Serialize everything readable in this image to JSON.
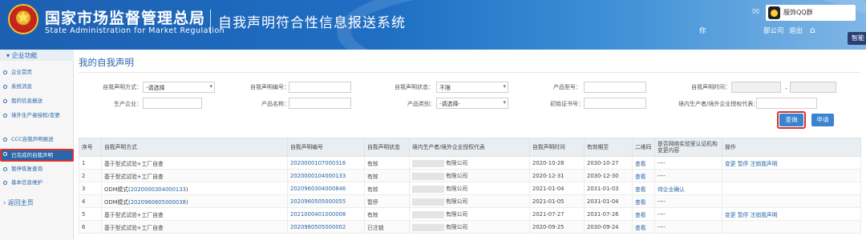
{
  "header": {
    "org_name_cn": "国家市场监督管理总局",
    "org_name_en": "State Administration  for  Market Regulation",
    "system_title": "自我声明符合性信息报送系统",
    "user_name": "服饰QQ群",
    "links": {
      "user_center": "你",
      "company": "部公司",
      "logout": "退出"
    },
    "smart_tab": "智能"
  },
  "sidebar": {
    "section": "企业功能",
    "items": [
      {
        "label": "企业首页"
      },
      {
        "label": "系统消息"
      },
      {
        "label": "我的信息报送"
      },
      {
        "label": "境外生产者授权/变更"
      },
      {
        "label": "CCC自我声明报送"
      },
      {
        "label": "已完成的自我声明"
      },
      {
        "label": "暂停恢复查询"
      },
      {
        "label": "基本信息维护"
      }
    ],
    "back": "返回主页"
  },
  "page_title": "我的自我声明",
  "filters": {
    "method_label": "自我声明方式：",
    "method_value": "-请选择",
    "number_label": "自我声明编号：",
    "status_label": "自我声明状态：",
    "status_value": "不限",
    "product_model_label": "产品型号：",
    "time_label": "自我声明时间：",
    "producer_label": "生产企业：",
    "product_name_label": "产品名称：",
    "category_label": "产品类别：",
    "category_value": "-请选择-",
    "cert_label": "初始证书号：",
    "agent_label": "境内生产者/境外企业授权代表："
  },
  "buttons": {
    "query": "查询",
    "apply": "申请"
  },
  "table": {
    "headers": [
      "序号",
      "自我声明方式",
      "自我声明编号",
      "自我声明状态",
      "境内生产者/境外企业授权代表",
      "自我声明时间",
      "有效期至",
      "二维码",
      "是否网络实验室认证机构变更内容",
      "操作"
    ],
    "rows": [
      {
        "no": "1",
        "method": "基于型式试验+工厂自查",
        "number": "2020000107000316",
        "status": "有效",
        "company": "有限公司",
        "date": "2020-10-28",
        "expiry": "2030-10-27",
        "qr": "查看",
        "change": "----",
        "ops": "变更 暂停 注销我声明"
      },
      {
        "no": "2",
        "method": "基于型式试验+工厂自查",
        "number": "2020000104000133",
        "status": "有效",
        "company": "有限公司",
        "date": "2020-12-31",
        "expiry": "2030-12-30",
        "qr": "查看",
        "change": "----",
        "ops": ""
      },
      {
        "no": "3",
        "method": "ODM模式(",
        "method_link": "2020000304000133",
        "method_end": ")",
        "number": "2020960304000846",
        "status": "有效",
        "company": "有限公司",
        "date": "2021-01-04",
        "expiry": "2031-01-03",
        "qr": "查看",
        "change": "待企业确认",
        "ops": ""
      },
      {
        "no": "4",
        "method": "ODM模式(",
        "method_link": "2020960605000038",
        "method_end": ")",
        "number": "2020960505000055",
        "status": "暂停",
        "company": "有限公司",
        "date": "2021-01-05",
        "expiry": "2031-01-04",
        "qr": "查看",
        "change": "----",
        "ops": ""
      },
      {
        "no": "5",
        "method": "基于型式试验+工厂自查",
        "number": "2021000401000008",
        "status": "有效",
        "company": "有限公司",
        "date": "2021-07-27",
        "expiry": "2031-07-26",
        "qr": "查看",
        "change": "----",
        "ops": "变更 暂停 注销我声明"
      },
      {
        "no": "6",
        "method": "基于型式试验+工厂自查",
        "number": "2020980505000002",
        "status": "已注销",
        "company": "有限公司",
        "date": "2020-09-25",
        "expiry": "2030-09-24",
        "qr": "查看",
        "change": "----",
        "ops": ""
      }
    ]
  },
  "colors": {
    "header_blue": "#1f6fc4",
    "link_blue": "#2a66a8",
    "highlight_red": "#d9322c",
    "button_blue": "#3a83cf"
  }
}
